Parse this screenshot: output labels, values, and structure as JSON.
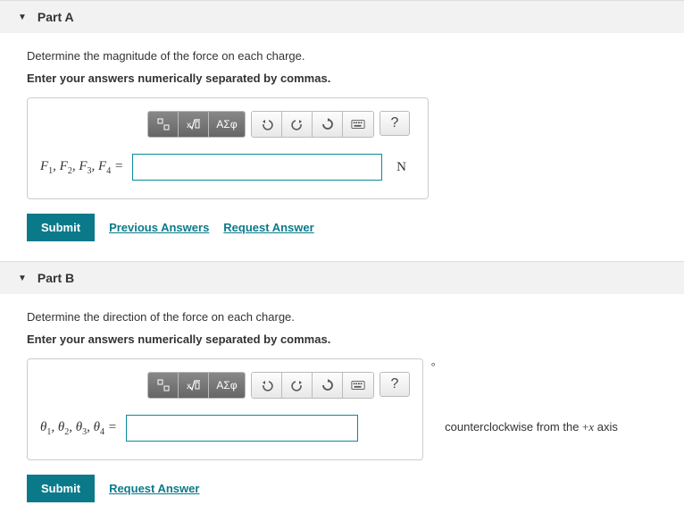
{
  "parts": [
    {
      "title": "Part A",
      "prompt": "Determine the magnitude of the force on each charge.",
      "instruction": "Enter your answers numerically separated by commas.",
      "var_label_html": "F1, F2, F3, F4 =",
      "unit": "N",
      "suffix": "",
      "submit": "Submit",
      "prev_answers": "Previous Answers",
      "request_answer": "Request Answer"
    },
    {
      "title": "Part B",
      "prompt": "Determine the direction of the force on each charge.",
      "instruction": "Enter your answers numerically separated by commas.",
      "var_label_html": "θ1, θ2, θ3, θ4 =",
      "unit_deg": "∘",
      "suffix": "counterclockwise from the +x axis",
      "submit": "Submit",
      "request_answer": "Request Answer"
    }
  ],
  "toolbar": {
    "greek": "ΑΣφ",
    "help": "?"
  }
}
